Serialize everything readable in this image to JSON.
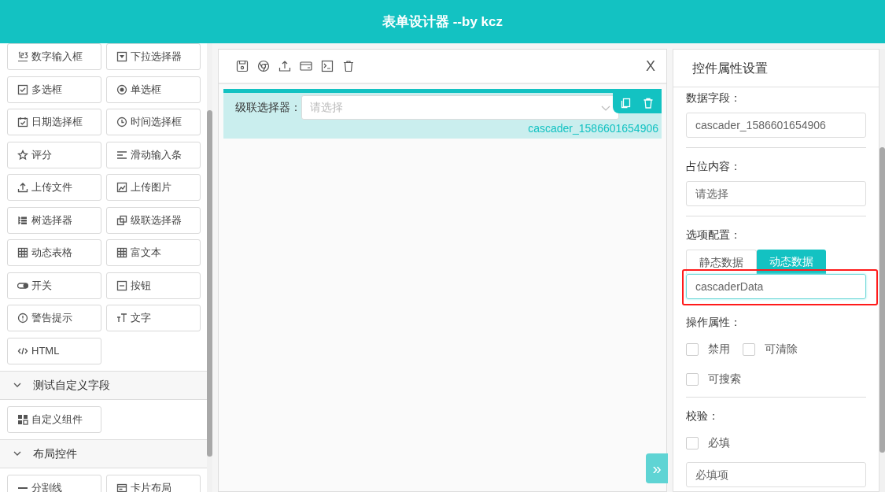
{
  "header": {
    "title": "表单设计器 --by kcz"
  },
  "component_groups": [
    {
      "items": [
        "数字输入框",
        "下拉选择器",
        "多选框",
        "单选框",
        "日期选择框",
        "时间选择框",
        "评分",
        "滑动输入条",
        "上传文件",
        "上传图片",
        "树选择器",
        "级联选择器",
        "动态表格",
        "富文本",
        "开关",
        "按钮",
        "警告提示",
        "文字",
        "HTML"
      ]
    },
    {
      "title": "测试自定义字段",
      "expanded": true,
      "items": [
        "自定义组件"
      ]
    },
    {
      "title": "布局控件",
      "expanded": true,
      "items": [
        "分割线",
        "卡片布局"
      ]
    }
  ],
  "canvas": {
    "close": "X",
    "field": {
      "label": "级联选择器：",
      "placeholder": "请选择",
      "model": "cascader_1586601654906",
      "selected": true
    },
    "collapse_toggle": "»"
  },
  "properties": {
    "title": "控件属性设置",
    "data_field": {
      "label": "数据字段：",
      "value": "cascader_1586601654906"
    },
    "placeholder_setting": {
      "label": "占位内容：",
      "value": "请选择"
    },
    "options": {
      "label": "选项配置：",
      "tabs": [
        {
          "label": "静态数据",
          "selected": false
        },
        {
          "label": "动态数据",
          "selected": true
        }
      ],
      "value": "cascaderData",
      "highlighted": true
    },
    "operations": {
      "label": "操作属性：",
      "checks": [
        {
          "label": "禁用",
          "checked": false
        },
        {
          "label": "可清除",
          "checked": false
        },
        {
          "label": "可搜索",
          "checked": false
        }
      ]
    },
    "validation": {
      "label": "校验：",
      "checks": [
        {
          "label": "必填",
          "checked": false
        }
      ],
      "message": "必填项"
    }
  }
}
